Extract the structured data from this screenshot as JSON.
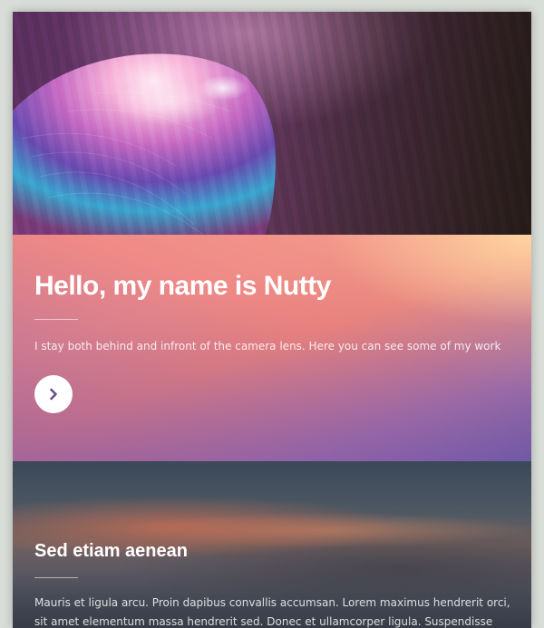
{
  "hero": {
    "image": "abstract-pink-shell-macro",
    "colors": {
      "primary": "#6a3a6a",
      "highlight": "#ffd9f0",
      "accent": "#3fb7d6"
    }
  },
  "intro": {
    "title": "Hello, my name is Nutty",
    "text": "I stay both behind and infront of the camera lens. Here you can see some of my work",
    "next_icon": "chevron-right-icon",
    "colors": {
      "gradient_start": "#ffd9a6",
      "gradient_mid": "#ef8a87",
      "gradient_end": "#6f5aa6"
    }
  },
  "section_two": {
    "background_image": "sunset-clouds",
    "title": "Sed etiam aenean",
    "text": "Mauris et ligula arcu. Proin dapibus convallis accumsan. Lorem maximus hendrerit orci, sit amet elementum massa hendrerit sed. Donec et ullamcorper ligula. Suspendisse eget potenti. Ut"
  }
}
